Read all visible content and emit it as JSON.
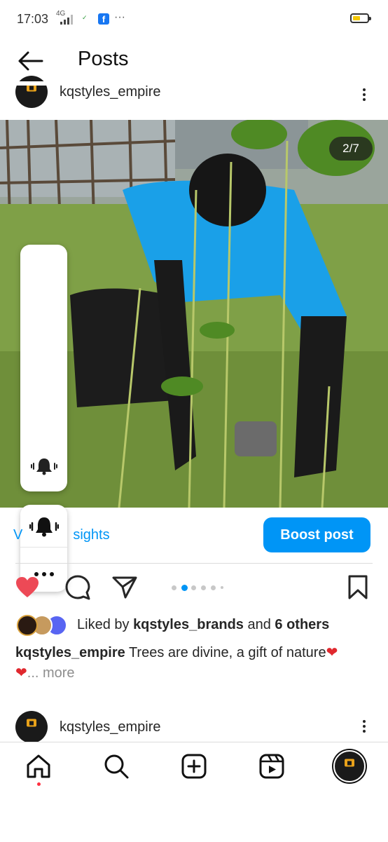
{
  "status_bar": {
    "time": "17:03",
    "network": "4G",
    "battery_level": 0.55,
    "battery_color": "#f4c700"
  },
  "header": {
    "back_icon": "arrow-left-icon",
    "title": "Posts"
  },
  "post": {
    "username": "kqstyles_empire",
    "page_counter": "2/7",
    "photo_description_icon": "photo",
    "insights_label": "View insights",
    "insights_visible": "V",
    "insights_tail": "sights",
    "boost_label": "Boost post",
    "carousel_pages": 7,
    "carousel_current": 2,
    "liked_by_prefix": "Liked by ",
    "liked_by_user": "kqstyles_brands",
    "liked_by_middle": " and ",
    "liked_by_others": "6 others",
    "caption_user": "kqstyles_empire",
    "caption_text": " Trees are divine, a gift of nature",
    "caption_more": "... more",
    "accent_color": "#0095f6",
    "heart_color": "#ed4956"
  },
  "next_post": {
    "username": "kqstyles_empire"
  },
  "volume_popup": {
    "level": 0.0,
    "bell_icon": "bell-ring-icon",
    "more_icon": "ellipsis-icon"
  },
  "bottom_nav": {
    "items": [
      "home-icon",
      "search-icon",
      "create-icon",
      "reels-icon",
      "profile-avatar"
    ]
  }
}
